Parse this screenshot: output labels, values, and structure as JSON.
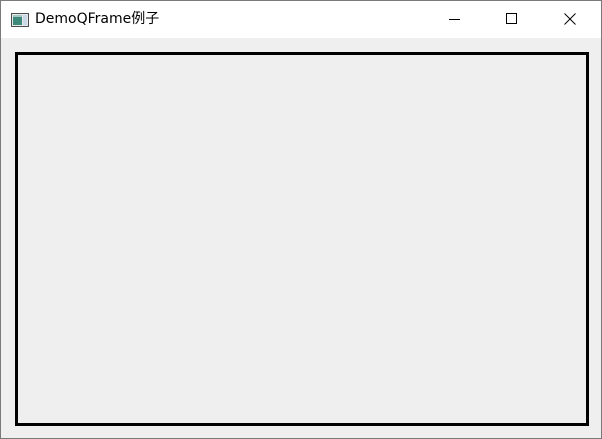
{
  "window": {
    "title": "DemoQFrame例子",
    "app_icon": "qt-window-icon",
    "controls": {
      "minimize_icon": "minimize-icon",
      "maximize_icon": "maximize-icon",
      "close_icon": "close-icon"
    }
  },
  "colors": {
    "titlebar_bg": "#ffffff",
    "client_bg": "#efefef",
    "frame_border": "#000000",
    "window_border": "#7a7a7a"
  },
  "frame": {
    "style": "box",
    "shadow": "plain"
  }
}
